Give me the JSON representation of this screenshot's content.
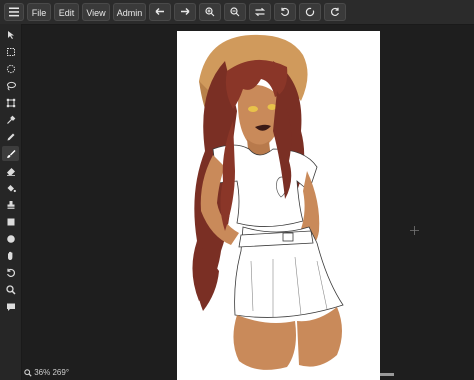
{
  "toolbar": {
    "menu_icon": "hamburger-icon",
    "file_label": "File",
    "edit_label": "Edit",
    "view_label": "View",
    "admin_label": "Admin",
    "icons": [
      "undo-icon",
      "redo-icon",
      "zoom-in-icon",
      "zoom-out-icon",
      "flip-icon",
      "rotate-left-icon",
      "reset-rotation-icon",
      "rotate-right-icon"
    ]
  },
  "tools": [
    "select-icon",
    "rect-select-icon",
    "ellipse-select-icon",
    "lasso-icon",
    "transform-icon",
    "eyedropper-icon",
    "pen-icon",
    "brush-icon",
    "eraser-icon",
    "fill-icon",
    "stamp-icon",
    "rectangle-icon",
    "ellipse-icon",
    "hand-icon",
    "rotate-icon",
    "zoom-icon",
    "comment-icon"
  ],
  "active_tool": "brush-icon",
  "status": {
    "zoom_icon": "magnifier-icon",
    "text": "36% 269°"
  },
  "colors": {
    "background": "#1f1f1f",
    "toolbar": "#2b2b2b",
    "button": "#3a3a3a",
    "canvas": "#ffffff",
    "hair": "#7a2f24",
    "skin": "#c98a5a"
  }
}
